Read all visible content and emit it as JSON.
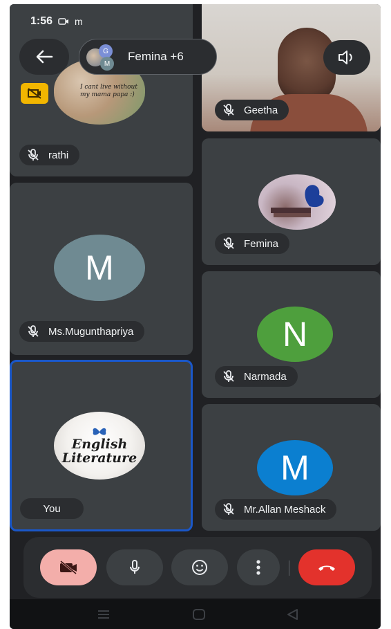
{
  "status_bar": {
    "time": "1:56",
    "extra": "m"
  },
  "header": {
    "participants_label": "Femina +6",
    "mini_avatars": [
      "G",
      "M"
    ]
  },
  "tiles": {
    "rathi": {
      "name": "rathi",
      "sticker_text": "I cant live without my mama papa :)"
    },
    "geetha": {
      "name": "Geetha"
    },
    "femina": {
      "name": "Femina"
    },
    "mugunthapriya": {
      "name": "Ms.Mugunthapriya",
      "initial": "M"
    },
    "narmada": {
      "name": "Narmada",
      "initial": "N"
    },
    "you": {
      "name": "You",
      "logo_line1": "English",
      "logo_line2": "Literature"
    },
    "allan": {
      "name": "Mr.Allan Meshack",
      "initial": "M"
    }
  },
  "colors": {
    "accent_blue": "#1a57c8",
    "avatar_gray": "#6f8a92",
    "avatar_green": "#4e9f3d",
    "avatar_blue": "#0b7fd0",
    "hangup_red": "#e3322c",
    "camera_off_bg": "#f3aeaa"
  },
  "icons": [
    "back-arrow-icon",
    "speaker-icon",
    "mic-off-icon",
    "camera-off-icon",
    "mic-icon",
    "emoji-icon",
    "more-vert-icon",
    "hang-up-icon",
    "no-video-badge-icon"
  ]
}
